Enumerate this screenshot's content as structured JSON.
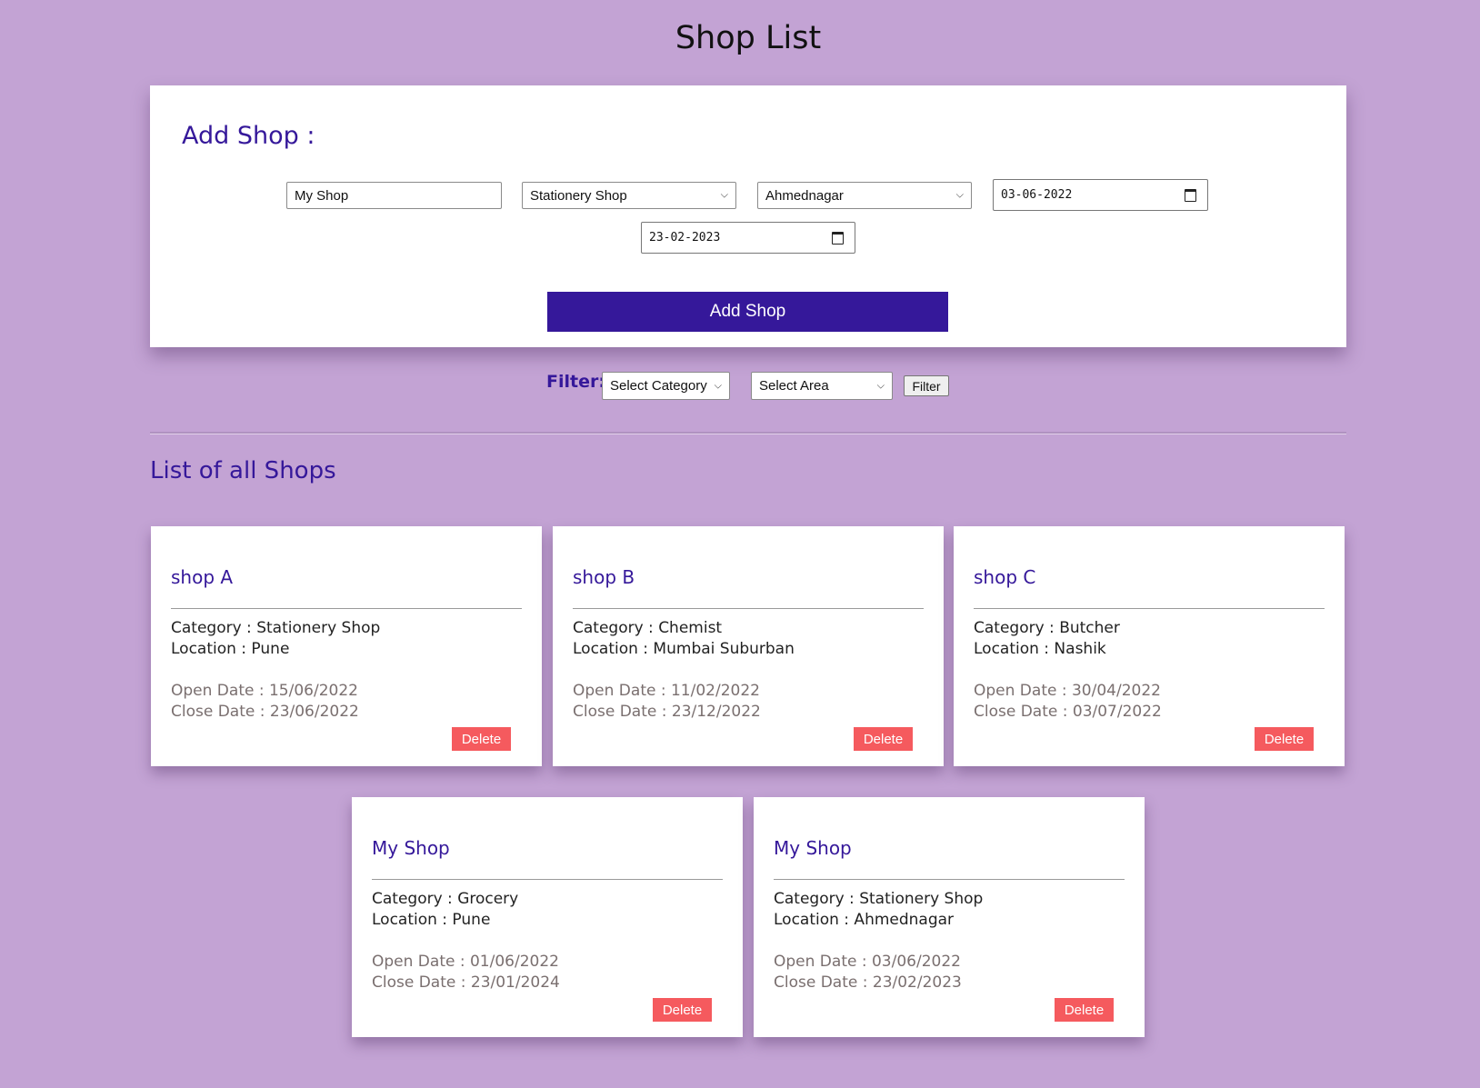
{
  "page_title": "Shop List",
  "add_form": {
    "heading": "Add Shop :",
    "name_value": "My Shop",
    "category_value": "Stationery Shop",
    "area_value": "Ahmednagar",
    "open_date": "03-06-2022",
    "close_date": "23-02-2023",
    "submit_label": "Add Shop"
  },
  "filter": {
    "label": "Filter:",
    "category_placeholder": "Select Category",
    "area_placeholder": "Select Area",
    "button_label": "Filter"
  },
  "list_heading": "List of all Shops",
  "shops": [
    {
      "name": "shop A",
      "category": "Category : Stationery Shop",
      "location": "Location : Pune",
      "open": "Open Date : 15/06/2022",
      "close": "Close Date : 23/06/2022",
      "delete_label": "Delete"
    },
    {
      "name": "shop B",
      "category": "Category : Chemist",
      "location": "Location : Mumbai Suburban",
      "open": "Open Date : 11/02/2022",
      "close": "Close Date : 23/12/2022",
      "delete_label": "Delete"
    },
    {
      "name": "shop C",
      "category": "Category : Butcher",
      "location": "Location : Nashik",
      "open": "Open Date : 30/04/2022",
      "close": "Close Date : 03/07/2022",
      "delete_label": "Delete"
    },
    {
      "name": "My Shop",
      "category": "Category : Grocery",
      "location": "Location : Pune",
      "open": "Open Date : 01/06/2022",
      "close": "Close Date : 23/01/2024",
      "delete_label": "Delete"
    },
    {
      "name": "My Shop",
      "category": "Category : Stationery Shop",
      "location": "Location : Ahmednagar",
      "open": "Open Date : 03/06/2022",
      "close": "Close Date : 23/02/2023",
      "delete_label": "Delete"
    }
  ],
  "colors": {
    "background": "#c3a3d4",
    "accent": "#35189a",
    "delete": "#f55a5e"
  }
}
